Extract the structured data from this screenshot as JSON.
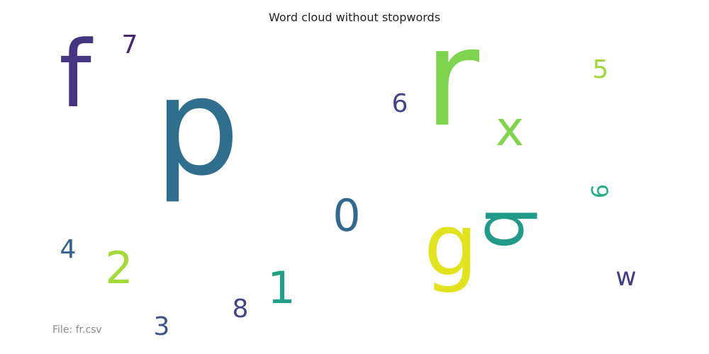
{
  "chart_data": {
    "type": "wordcloud",
    "title": "Word cloud without stopwords",
    "words": [
      {
        "text": "r",
        "weight": 10,
        "color": "#7ed44e",
        "rotated": false
      },
      {
        "text": "p",
        "weight": 9,
        "color": "#2f6e8c",
        "rotated": false
      },
      {
        "text": "f",
        "weight": 7,
        "color": "#463580",
        "rotated": false
      },
      {
        "text": "g",
        "weight": 6,
        "color": "#e2e21e",
        "rotated": false
      },
      {
        "text": "b",
        "weight": 5,
        "color": "#229a8a",
        "rotated": true
      },
      {
        "text": "x",
        "weight": 4,
        "color": "#82d34e",
        "rotated": false
      },
      {
        "text": "0",
        "weight": 3,
        "color": "#31688e",
        "rotated": false
      },
      {
        "text": "2",
        "weight": 3,
        "color": "#a4d93a",
        "rotated": false
      },
      {
        "text": "1",
        "weight": 3,
        "color": "#1fa187",
        "rotated": false
      },
      {
        "text": "3",
        "weight": 2,
        "color": "#3a548c",
        "rotated": false
      },
      {
        "text": "w",
        "weight": 2,
        "color": "#433e85",
        "rotated": false
      },
      {
        "text": "5",
        "weight": 2,
        "color": "#9dd93b",
        "rotated": false
      },
      {
        "text": "4",
        "weight": 2,
        "color": "#34618d",
        "rotated": false
      },
      {
        "text": "6",
        "weight": 2,
        "color": "#404688",
        "rotated": false
      },
      {
        "text": "7",
        "weight": 2,
        "color": "#482475",
        "rotated": false
      },
      {
        "text": "8",
        "weight": 2,
        "color": "#414487",
        "rotated": false
      },
      {
        "text": "9",
        "weight": 1,
        "color": "#2aae80",
        "rotated": true
      }
    ]
  },
  "footer": "File: fr.csv"
}
